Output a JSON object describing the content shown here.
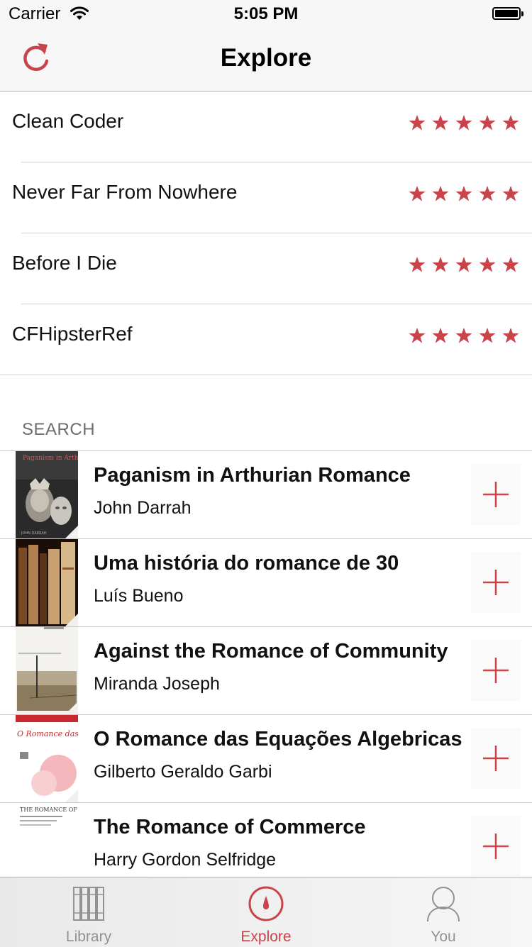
{
  "status_bar": {
    "carrier": "Carrier",
    "time": "5:05 PM"
  },
  "nav": {
    "title": "Explore",
    "left_icon": "refresh-icon"
  },
  "colors": {
    "accent": "#c9444a",
    "separator": "#c8c7cc",
    "section_text": "#6d6d72"
  },
  "top_books": [
    {
      "title": "Clean Coder",
      "rating": 5
    },
    {
      "title": "Never Far From Nowhere",
      "rating": 5
    },
    {
      "title": "Before I Die",
      "rating": 5
    },
    {
      "title": "CFHipsterRef",
      "rating": 5
    }
  ],
  "search": {
    "header": "SEARCH",
    "results": [
      {
        "title": "Paganism in Arthurian Romance",
        "author": "John Darrah",
        "cover_text": "Paganism in Arthurian Romance",
        "cover_footer": "JOHN DARRAH"
      },
      {
        "title": "Uma história do romance de 30",
        "author": "Luís Bueno"
      },
      {
        "title": "Against the Romance of Community",
        "author": "Miranda Joseph"
      },
      {
        "title": "O Romance das Equações Algebricas",
        "author": "Gilberto Geraldo Garbi",
        "cover_text": "O Romance das Equações Algébricas"
      },
      {
        "title": "The Romance of Commerce",
        "author": "Harry Gordon Selfridge",
        "cover_text": "THE ROMANCE OF COMMERCE"
      }
    ]
  },
  "tabs": [
    {
      "label": "Library",
      "icon": "library-icon",
      "active": false
    },
    {
      "label": "Explore",
      "icon": "compass-icon",
      "active": true
    },
    {
      "label": "You",
      "icon": "person-icon",
      "active": false
    }
  ]
}
